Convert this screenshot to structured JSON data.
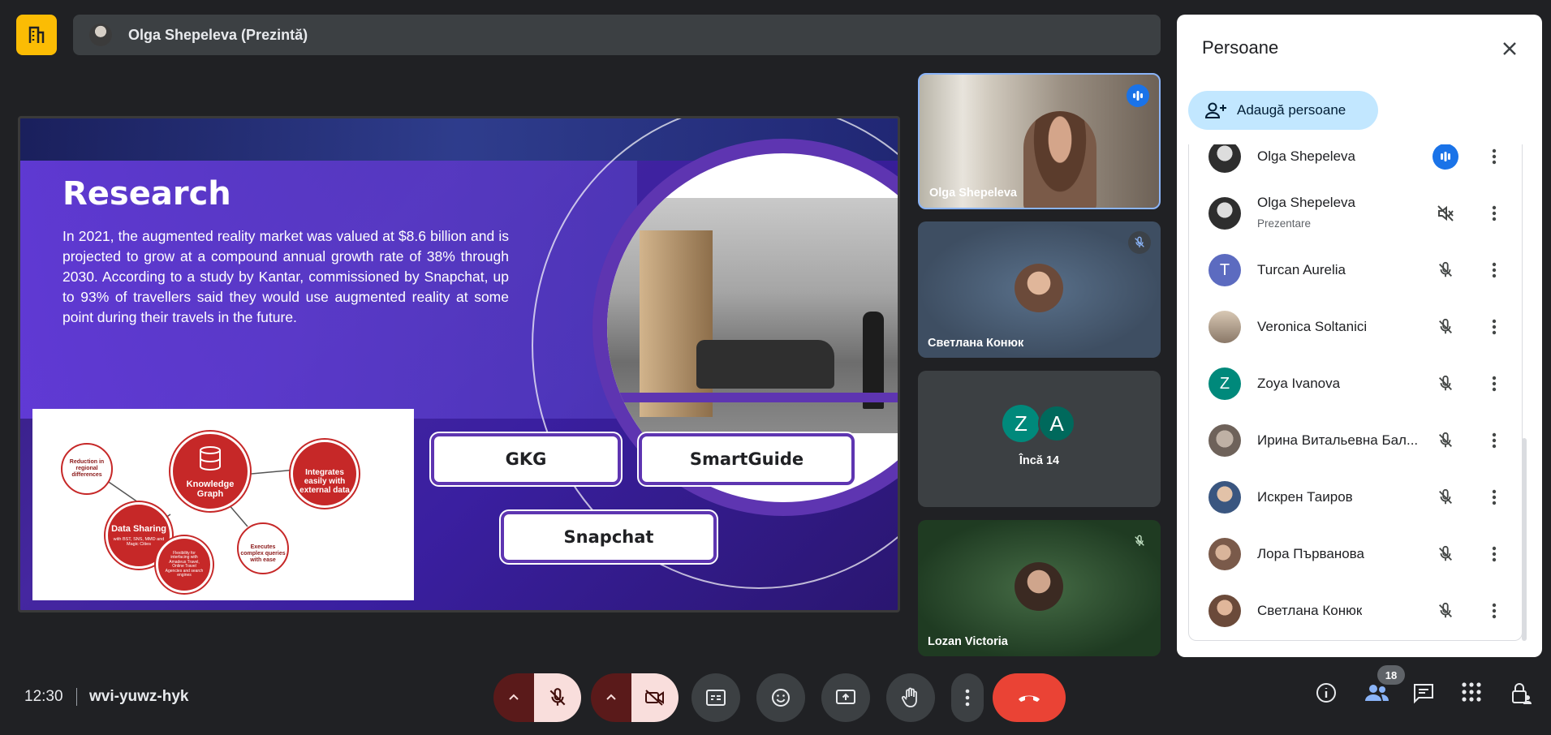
{
  "presenter_bar": {
    "title": "Olga Shepeleva (Prezintă)"
  },
  "slide": {
    "title": "Research",
    "body": "In 2021, the augmented reality market was valued at $8.6 billion and is projected to grow at a compound annual growth rate of 38% through 2030. According to a study by Kantar, commissioned by Snapchat, up to 93% of travellers said they would use augmented reality at some point during their travels in the future.",
    "pills": [
      "GKG",
      "SmartGuide",
      "Snapchat"
    ],
    "diagram": {
      "center": "Knowledge Graph",
      "integrates": "Integrates easily with external data",
      "data_sharing": "Data Sharing",
      "data_sharing_sub": "with BST, SNS, MMD and Magic Cities",
      "reduction": "Reduction in regional differences",
      "flexibility": "Flexibility for interfacing with Amadeus Travel, Online Travel Agencies and search engines",
      "executes": "Executes complex queries with ease"
    }
  },
  "tiles": [
    {
      "name": "Olga Shepeleva"
    },
    {
      "name": "Светлана Конюк"
    },
    {
      "more": "Încă 14",
      "letters": [
        "Z",
        "A"
      ]
    },
    {
      "name": "Lozan Victoria"
    }
  ],
  "bottom": {
    "time": "12:30",
    "code": "wvi-yuwz-hyk",
    "people_count": "18"
  },
  "panel": {
    "title": "Persoane",
    "add_label": "Adaugă persoane",
    "participants": [
      {
        "name": "Olga Shepeleva",
        "sub": "",
        "avatar": "photo",
        "mic": "speaking"
      },
      {
        "name": "Olga Shepeleva",
        "sub": "Prezentare",
        "avatar": "photo",
        "mic": "presenting"
      },
      {
        "name": "Turcan Aurelia",
        "sub": "",
        "avatar": "T",
        "avatar_color": "#5c6bc0",
        "mic": "muted"
      },
      {
        "name": "Veronica Soltanici",
        "sub": "",
        "avatar": "photo",
        "mic": "muted"
      },
      {
        "name": "Zoya Ivanova",
        "sub": "",
        "avatar": "Z",
        "avatar_color": "#00897b",
        "mic": "muted"
      },
      {
        "name": "Ирина Витальевна Бал...",
        "sub": "",
        "avatar": "photo",
        "mic": "muted"
      },
      {
        "name": "Искрен Таиров",
        "sub": "",
        "avatar": "photo",
        "mic": "muted"
      },
      {
        "name": "Лора Първанова",
        "sub": "",
        "avatar": "photo",
        "mic": "muted"
      },
      {
        "name": "Светлана Конюк",
        "sub": "",
        "avatar": "photo",
        "mic": "muted"
      }
    ]
  },
  "colors": {
    "accent": "#1a73e8",
    "end_call": "#ea4335",
    "logo": "#fbbc04",
    "mute_bg": "#f9dedc"
  }
}
